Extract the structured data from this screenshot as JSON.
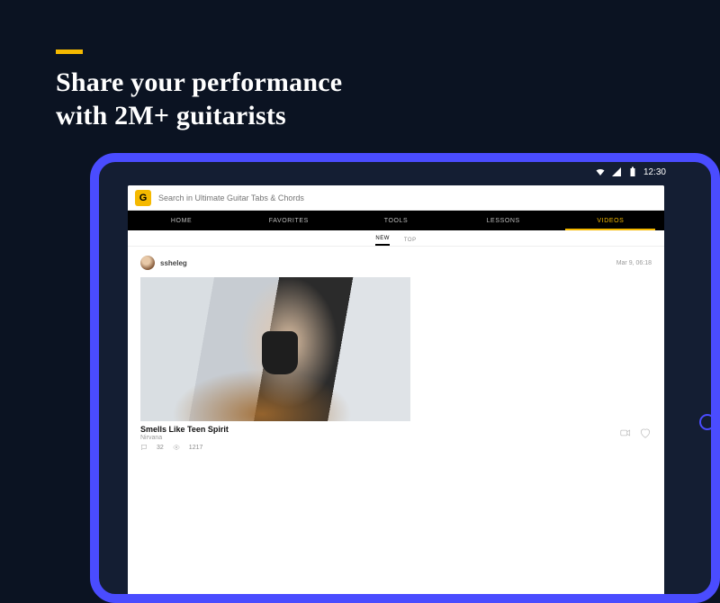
{
  "promo": {
    "headline_line1": "Share your performance",
    "headline_line2": "with 2M+ guitarists"
  },
  "statusbar": {
    "time": "12:30"
  },
  "app": {
    "search_placeholder": "Search in Ultimate Guitar Tabs & Chords",
    "tabs": [
      {
        "label": "HOME"
      },
      {
        "label": "FAVORITES"
      },
      {
        "label": "TOOLS"
      },
      {
        "label": "LESSONS"
      },
      {
        "label": "VIDEOS",
        "active": true
      }
    ],
    "subfilter": [
      {
        "label": "NEW",
        "active": true
      },
      {
        "label": "TOP"
      }
    ],
    "post": {
      "username": "ssheleg",
      "date": "Mar 9, 06:18",
      "title": "Smells Like Teen Spirit",
      "artist": "Nirvana",
      "comments": "32",
      "views": "1217"
    }
  }
}
